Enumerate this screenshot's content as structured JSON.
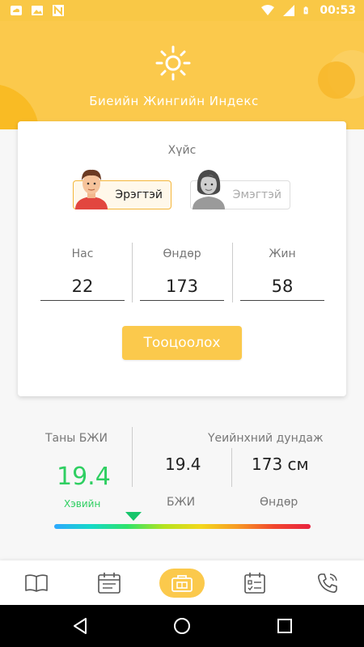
{
  "status_bar": {
    "time": "00:53",
    "left_icons": [
      "cloud-notification-icon",
      "image-notification-icon",
      "n-notification-icon"
    ],
    "right_icons": [
      "wifi-icon",
      "cell-signal-icon",
      "battery-charging-icon"
    ]
  },
  "header": {
    "title": "Биеийн Жингийн Индекс",
    "icon": "sun-icon"
  },
  "form": {
    "gender_title": "Хүйс",
    "male_label": "Эрэгтэй",
    "female_label": "Эмэгтэй",
    "selected_gender": "Эрэгтэй",
    "age_label": "Нас",
    "age_value": "22",
    "height_label": "Өндөр",
    "height_value": "173",
    "weight_label": "Жин",
    "weight_value": "58",
    "calculate_label": "Тооцоолох"
  },
  "result": {
    "title": "Таны БЖИ",
    "bmi_value": "19.4",
    "status": "Хэвийн",
    "average_title": "Үеийнхний дундаж",
    "average_bmi": "19.4",
    "average_bmi_label": "БЖИ",
    "average_height": "173 см",
    "average_height_label": "Өндөр",
    "gauge_position": 0.31
  },
  "bottom_nav": {
    "items": [
      "book-icon",
      "calendar-icon",
      "calculator-icon",
      "checklist-icon",
      "phone-icon"
    ],
    "active_index": 2
  },
  "colors": {
    "accent": "#fbc94c",
    "normal_status": "#2fcf62"
  }
}
